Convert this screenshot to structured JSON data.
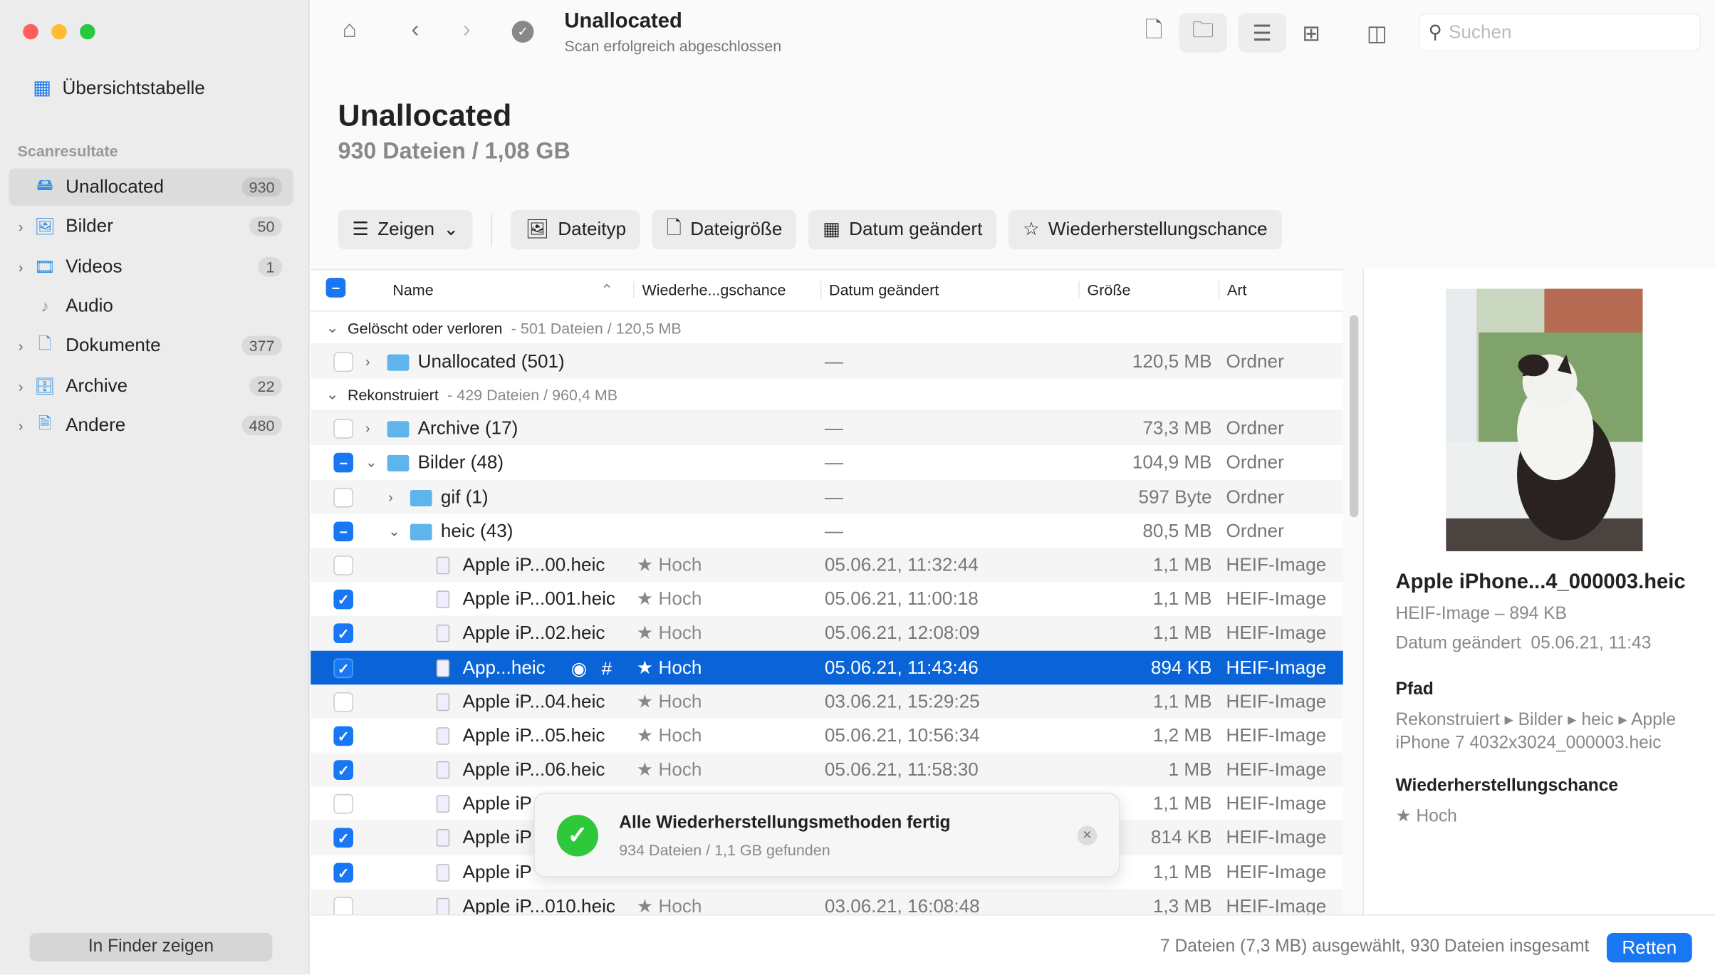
{
  "window": {
    "colors": {
      "close": "#ff5f57",
      "minimize": "#febc2e",
      "zoom": "#28c840",
      "accent": "#1877f2",
      "success": "#2fc83a"
    }
  },
  "sidebar": {
    "overview": "Übersichtstabelle",
    "section": "Scanresultate",
    "items": [
      {
        "label": "Unallocated",
        "count": "930",
        "icon": "drive-icon",
        "active": true
      },
      {
        "label": "Bilder",
        "count": "50",
        "icon": "image-icon"
      },
      {
        "label": "Videos",
        "count": "1",
        "icon": "film-icon"
      },
      {
        "label": "Audio",
        "count": "",
        "icon": "music-note-icon"
      },
      {
        "label": "Dokumente",
        "count": "377",
        "icon": "document-icon"
      },
      {
        "label": "Archive",
        "count": "22",
        "icon": "archive-icon"
      },
      {
        "label": "Andere",
        "count": "480",
        "icon": "other-file-icon"
      }
    ],
    "finder_button": "In Finder zeigen"
  },
  "toolbar": {
    "title": "Unallocated",
    "subtitle": "Scan erfolgreich abgeschlossen",
    "search_placeholder": "Suchen"
  },
  "header": {
    "title": "Unallocated",
    "summary": "930 Dateien / 1,08 GB"
  },
  "filters": {
    "show": "Zeigen",
    "filetype": "Dateityp",
    "filesize": "Dateigröße",
    "date": "Datum geändert",
    "chance": "Wiederherstellungschance"
  },
  "table": {
    "columns": {
      "name": "Name",
      "chance": "Wiederhe...gschance",
      "date": "Datum geändert",
      "size": "Größe",
      "kind": "Art"
    },
    "groups": [
      {
        "label": "Gelöscht oder verloren",
        "info": "- 501 Dateien / 120,5 MB"
      },
      {
        "label": "Rekonstruiert",
        "info": "- 429 Dateien / 960,4 MB"
      }
    ],
    "rows_group1": [
      {
        "name": "Unallocated (501)",
        "check": "none",
        "level": 0,
        "expander": "›",
        "icon": "folder",
        "chance": "",
        "date": "—",
        "size": "120,5 MB",
        "kind": "Ordner"
      }
    ],
    "rows_group2": [
      {
        "name": "Archive (17)",
        "check": "none",
        "level": 0,
        "expander": "›",
        "icon": "folder",
        "chance": "",
        "date": "—",
        "size": "73,3 MB",
        "kind": "Ordner"
      },
      {
        "name": "Bilder (48)",
        "check": "mixed",
        "level": 0,
        "expander": "⌄",
        "icon": "folder",
        "chance": "",
        "date": "—",
        "size": "104,9 MB",
        "kind": "Ordner"
      },
      {
        "name": "gif (1)",
        "check": "none",
        "level": 1,
        "expander": "›",
        "icon": "folder",
        "chance": "",
        "date": "—",
        "size": "597 Byte",
        "kind": "Ordner"
      },
      {
        "name": "heic (43)",
        "check": "mixed",
        "level": 1,
        "expander": "⌄",
        "icon": "folder",
        "chance": "",
        "date": "—",
        "size": "80,5 MB",
        "kind": "Ordner"
      },
      {
        "name": "Apple iP...00.heic",
        "check": "none",
        "level": 2,
        "icon": "file",
        "chance": "Hoch",
        "date": "05.06.21, 11:32:44",
        "size": "1,1 MB",
        "kind": "HEIF-Image"
      },
      {
        "name": "Apple iP...001.heic",
        "check": "checked",
        "level": 2,
        "icon": "file",
        "chance": "Hoch",
        "date": "05.06.21, 11:00:18",
        "size": "1,1 MB",
        "kind": "HEIF-Image"
      },
      {
        "name": "Apple iP...02.heic",
        "check": "checked",
        "level": 2,
        "icon": "file",
        "chance": "Hoch",
        "date": "05.06.21, 12:08:09",
        "size": "1,1 MB",
        "kind": "HEIF-Image"
      },
      {
        "name": "App...heic",
        "check": "checked",
        "level": 2,
        "icon": "file",
        "chance": "Hoch",
        "date": "05.06.21, 11:43:46",
        "size": "894 KB",
        "kind": "HEIF-Image",
        "selected": true
      },
      {
        "name": "Apple iP...04.heic",
        "check": "none",
        "level": 2,
        "icon": "file",
        "chance": "Hoch",
        "date": "03.06.21, 15:29:25",
        "size": "1,1 MB",
        "kind": "HEIF-Image"
      },
      {
        "name": "Apple iP...05.heic",
        "check": "checked",
        "level": 2,
        "icon": "file",
        "chance": "Hoch",
        "date": "05.06.21, 10:56:34",
        "size": "1,2 MB",
        "kind": "HEIF-Image"
      },
      {
        "name": "Apple iP...06.heic",
        "check": "checked",
        "level": 2,
        "icon": "file",
        "chance": "Hoch",
        "date": "05.06.21, 11:58:30",
        "size": "1 MB",
        "kind": "HEIF-Image"
      },
      {
        "name": "Apple iP",
        "check": "none",
        "level": 2,
        "icon": "file",
        "chance": "",
        "date": "",
        "size": "1,1 MB",
        "kind": "HEIF-Image"
      },
      {
        "name": "Apple iP",
        "check": "checked",
        "level": 2,
        "icon": "file",
        "chance": "",
        "date": "",
        "size": "814 KB",
        "kind": "HEIF-Image"
      },
      {
        "name": "Apple iP",
        "check": "checked",
        "level": 2,
        "icon": "file",
        "chance": "",
        "date": "",
        "size": "1,1 MB",
        "kind": "HEIF-Image"
      },
      {
        "name": "Apple iP...010.heic",
        "check": "none",
        "level": 2,
        "icon": "file",
        "chance": "Hoch",
        "date": "03.06.21, 16:08:48",
        "size": "1,3 MB",
        "kind": "HEIF-Image"
      }
    ]
  },
  "detail": {
    "name": "Apple iPhone...4_000003.heic",
    "type_size": "HEIF-Image – 894 KB",
    "date_label": "Datum geändert",
    "date": "05.06.21, 11:43",
    "path_label": "Pfad",
    "path": "Rekonstruiert ▸ Bilder ▸ heic ▸ Apple iPhone 7 4032x3024_000003.heic",
    "chance_label": "Wiederherstellungschance",
    "chance": "Hoch"
  },
  "footer": {
    "status": "7 Dateien (7,3 MB) ausgewählt, 930 Dateien insgesamt",
    "recover": "Retten"
  },
  "toast": {
    "title": "Alle Wiederherstellungsmethoden fertig",
    "message": "934 Dateien / 1,1 GB gefunden"
  }
}
